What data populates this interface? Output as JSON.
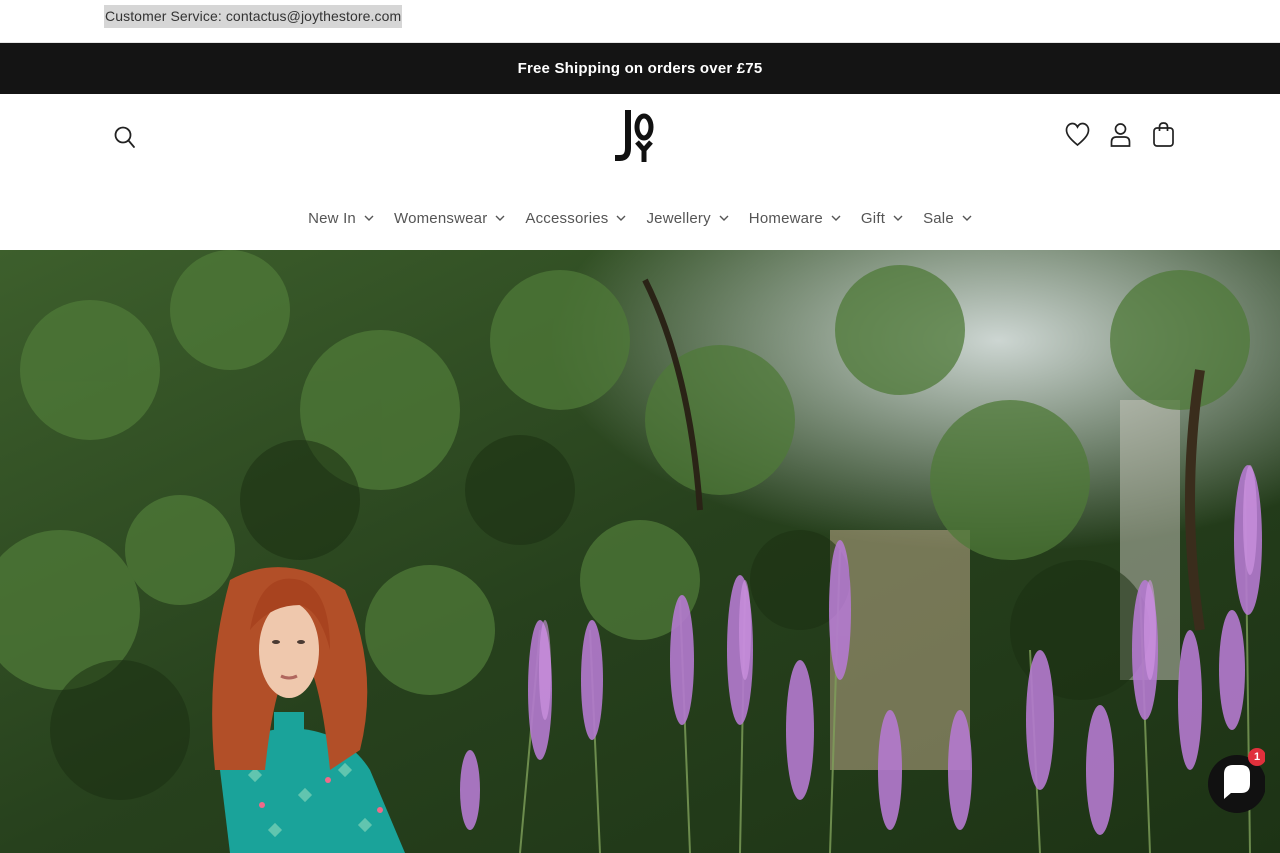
{
  "utility": {
    "customer_service": "Customer Service: contactus@joythestore.com"
  },
  "announcement": {
    "text": "Free Shipping on orders over £75"
  },
  "header": {
    "logo_text": "JOY",
    "icons": [
      "search-icon",
      "heart-icon",
      "account-icon",
      "cart-icon"
    ]
  },
  "nav": {
    "items": [
      {
        "label": "New In"
      },
      {
        "label": "Womenswear"
      },
      {
        "label": "Accessories"
      },
      {
        "label": "Jewellery"
      },
      {
        "label": "Homeware"
      },
      {
        "label": "Gift"
      },
      {
        "label": "Sale"
      }
    ]
  },
  "chat": {
    "badge_count": "1"
  },
  "colors": {
    "announcement_bg": "#141414",
    "chat_bg": "#111111",
    "badge": "#e0303c"
  }
}
